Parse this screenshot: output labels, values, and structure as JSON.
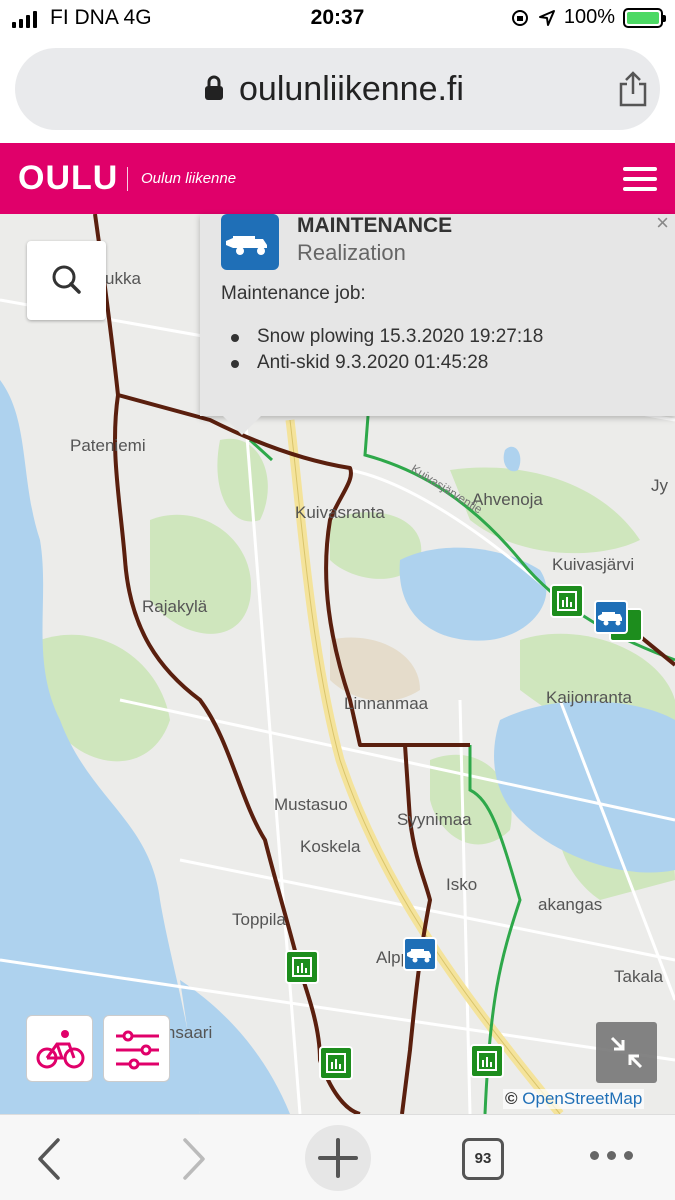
{
  "status_bar": {
    "carrier": "FI DNA   4G",
    "time": "20:37",
    "battery": "100%"
  },
  "browser": {
    "url": "oulunliikenne.fi",
    "tab_count": "93"
  },
  "header": {
    "logo": "OULU",
    "subtitle": "Oulun liikenne"
  },
  "popup": {
    "title": "MAINTENANCE",
    "subtitle": "Realization",
    "label": "Maintenance job:",
    "items": [
      "Snow plowing 15.3.2020 19:27:18",
      "Anti-skid 9.3.2020 01:45:28"
    ],
    "close": "×"
  },
  "map": {
    "places": [
      "ukka",
      "Pateniemi",
      "Kuivasranta",
      "Ahvenoja",
      "Jy",
      "Kuivasjärvi",
      "Rajakylä",
      "Linnanmaa",
      "Kaijonranta",
      "Mustasuo",
      "Syynimaa",
      "Koskela",
      "Isko",
      "akangas",
      "Toppila",
      "Alppila",
      "Takala",
      "ppilansaari",
      "Kuivasjärventie"
    ],
    "attribution_symbol": "©",
    "attribution_link": "OpenStreetMap"
  },
  "icons": {
    "search": "search-icon",
    "bike": "bicycle-icon",
    "filters": "filter-sliders-icon",
    "collapse": "collapse-arrows-icon",
    "maintenance": "snowplow-truck-icon",
    "weather_station": "weather-station-icon"
  },
  "colors": {
    "brand": "#e0006a",
    "maintenance_blue": "#1f6fb7",
    "station_green": "#1d8d1d",
    "route_brown": "#5a1f0e",
    "bike_route_green": "#2ea84a",
    "water": "#aed2ee"
  }
}
